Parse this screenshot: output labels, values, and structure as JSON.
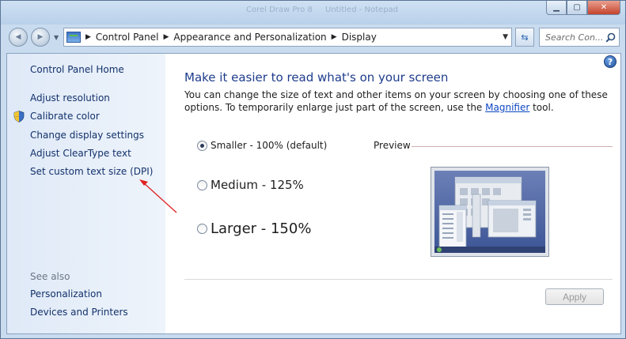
{
  "window": {
    "background_titles": [
      "Corel Draw Pro 8",
      "Untitled - Notepad"
    ],
    "buttons": {
      "minimize": "▁",
      "maximize": "▢",
      "close": "✕"
    }
  },
  "navigation": {
    "back_glyph": "◀",
    "forward_glyph": "▶",
    "breadcrumbs": [
      "Control Panel",
      "Appearance and Personalization",
      "Display"
    ],
    "search_placeholder": "Search Con..."
  },
  "sidebar": {
    "home": "Control Panel Home",
    "tasks": [
      "Adjust resolution",
      "Calibrate color",
      "Change display settings",
      "Adjust ClearType text",
      "Set custom text size (DPI)"
    ],
    "see_also_heading": "See also",
    "see_also": [
      "Personalization",
      "Devices and Printers"
    ]
  },
  "main": {
    "title": "Make it easier to read what's on your screen",
    "description_before": "You can change the size of text and other items on your screen by choosing one of these options. To temporarily enlarge just part of the screen, use the ",
    "description_link": "Magnifier",
    "description_after": " tool.",
    "options": [
      {
        "label": "Smaller - 100% (default)",
        "checked": true
      },
      {
        "label": "Medium - 125%",
        "checked": false
      },
      {
        "label": "Larger - 150%",
        "checked": false
      }
    ],
    "preview_label": "Preview",
    "apply_label": "Apply",
    "help_glyph": "?"
  },
  "colors": {
    "link": "#12316b",
    "title": "#1e3c8c",
    "annotation_arrow": "#e02020"
  }
}
